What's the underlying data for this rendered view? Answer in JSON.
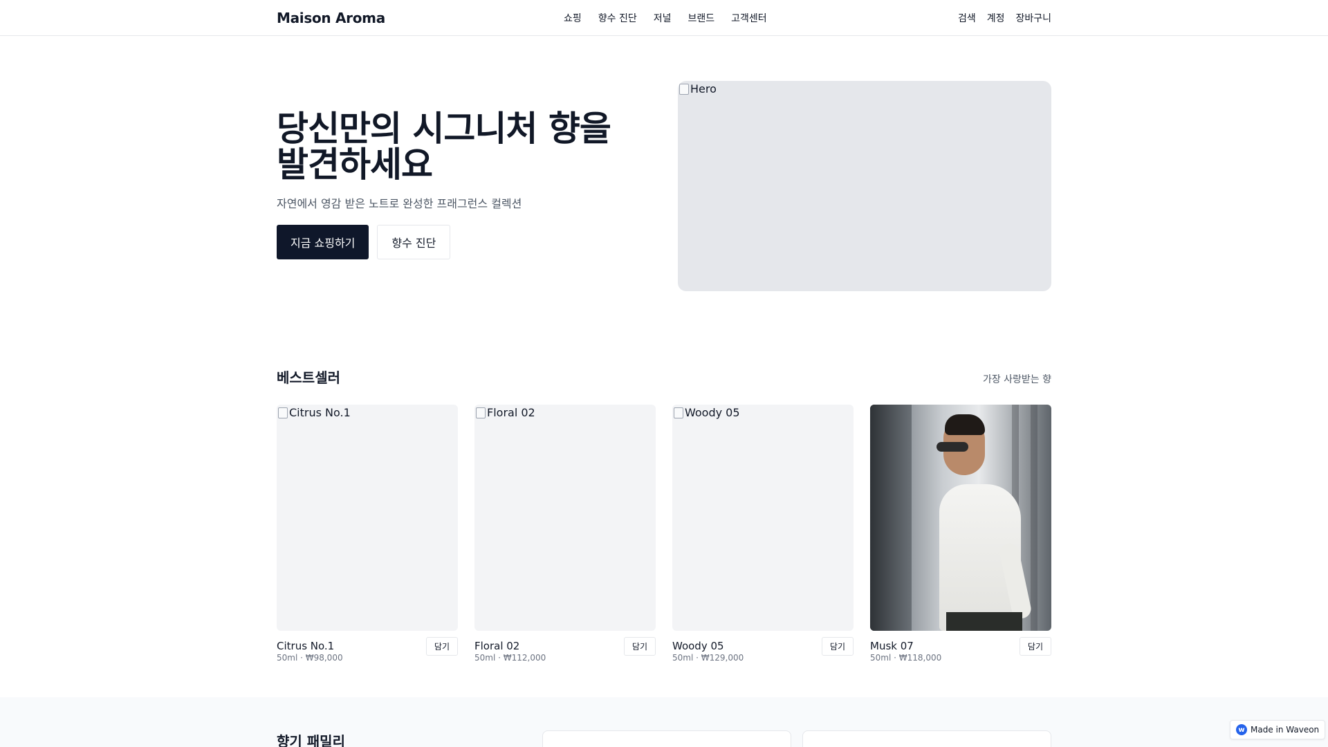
{
  "header": {
    "brand": "Maison Aroma",
    "nav": [
      "쇼핑",
      "향수 진단",
      "저널",
      "브랜드",
      "고객센터"
    ],
    "utility": [
      "검색",
      "계정",
      "장바구니"
    ]
  },
  "hero": {
    "title": "당신만의 시그니처 향을 발견하세요",
    "subtitle": "자연에서 영감 받은 노트로 완성한 프래그런스 컬렉션",
    "primary_cta": "지금 쇼핑하기",
    "secondary_cta": "향수 진단",
    "image_alt": "Hero"
  },
  "bestsellers": {
    "title": "베스트셀러",
    "note": "가장 사랑받는 향",
    "add_label": "담기",
    "products": [
      {
        "name": "Citrus No.1",
        "meta": "50ml · ₩98,000",
        "image_alt": "Citrus No.1"
      },
      {
        "name": "Floral 02",
        "meta": "50ml · ₩112,000",
        "image_alt": "Floral 02"
      },
      {
        "name": "Woody 05",
        "meta": "50ml · ₩129,000",
        "image_alt": "Woody 05"
      },
      {
        "name": "Musk 07",
        "meta": "50ml · ₩118,000",
        "image_alt": ""
      }
    ]
  },
  "family": {
    "title": "향기 패밀리"
  },
  "badge": {
    "icon": "waveon-logo-icon",
    "label": "Made in Waveon"
  },
  "colors": {
    "primary": "#0f172a",
    "hero_placeholder": "#e5e7eb",
    "card_placeholder": "#f3f4f6",
    "section_bg": "#f8fafc"
  }
}
